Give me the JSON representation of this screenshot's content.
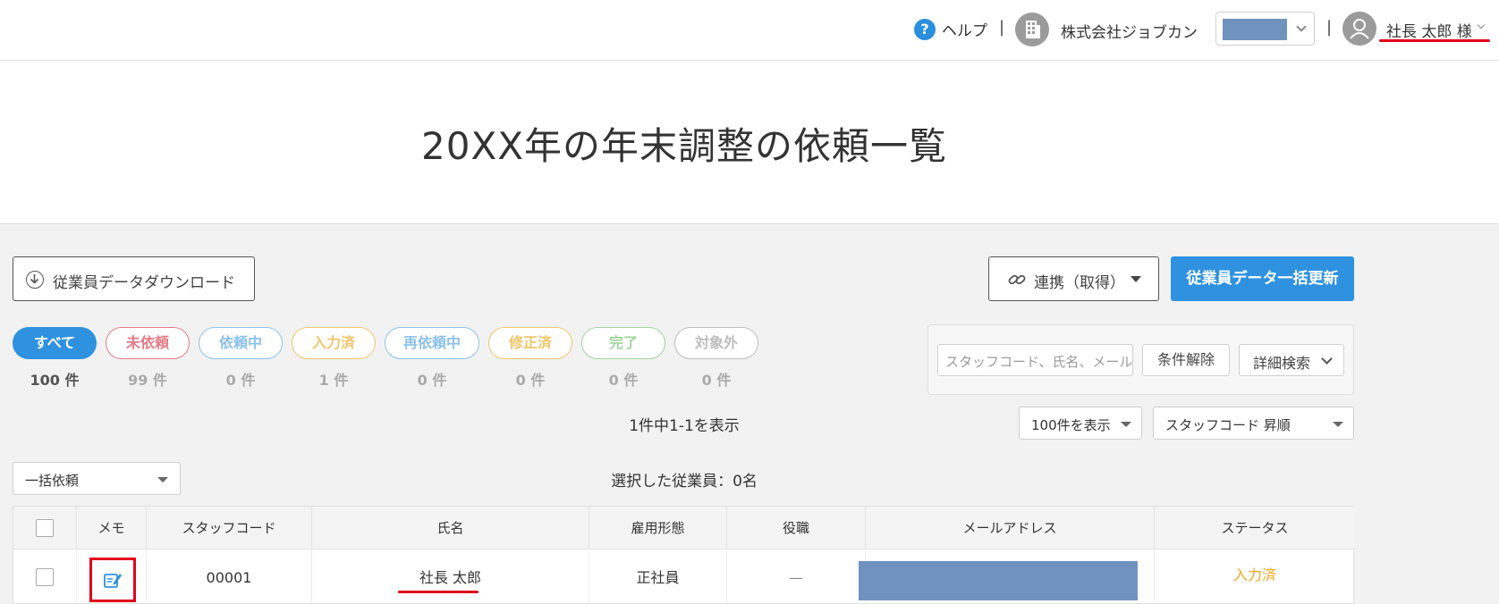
{
  "header": {
    "help_label": "ヘルプ",
    "separator": "|",
    "company_name": "株式会社ジョブカン",
    "user_name": "社長 太郎 様"
  },
  "page_title": "20XX年の年末調整の依頼一覧",
  "buttons": {
    "download": "従業員データダウンロード",
    "sync": "連携（取得）",
    "bulk_update": "従業員データ一括更新"
  },
  "status_filters": [
    {
      "label": "すべて",
      "count": "100 件",
      "color": "#2f92e0",
      "active": true
    },
    {
      "label": "未依頼",
      "count": "99 件",
      "color": "#e57a86",
      "active": false
    },
    {
      "label": "依頼中",
      "count": "0 件",
      "color": "#8cc1ea",
      "active": false
    },
    {
      "label": "入力済",
      "count": "1 件",
      "color": "#f0c56b",
      "active": false
    },
    {
      "label": "再依頼中",
      "count": "0 件",
      "color": "#8cc1ea",
      "active": false
    },
    {
      "label": "修正済",
      "count": "0 件",
      "color": "#f0c56b",
      "active": false
    },
    {
      "label": "完了",
      "count": "0 件",
      "color": "#9fd49c",
      "active": false
    },
    {
      "label": "対象外",
      "count": "0 件",
      "color": "#bdbdbd",
      "active": false
    }
  ],
  "search": {
    "placeholder": "スタッフコード、氏名、メールアドレス",
    "clear_label": "条件解除",
    "detail_label": "詳細検索"
  },
  "result_count": "1件中1-1を表示",
  "per_page_select": "100件を表示",
  "sort_select": "スタッフコード 昇順",
  "bulk_action_select": "一括依頼",
  "selected_count": "選択した従業員：0名",
  "table": {
    "headers": {
      "memo": "メモ",
      "staff_code": "スタッフコード",
      "name": "氏名",
      "employment_type": "雇用形態",
      "position": "役職",
      "email": "メールアドレス",
      "status": "ステータス"
    },
    "rows": [
      {
        "staff_code": "00001",
        "name": "社長 太郎",
        "employment_type": "正社員",
        "position": "—",
        "status": "入力済"
      }
    ]
  },
  "colors": {
    "accent": "#2f92e0",
    "status_input_done": "#f0a81c",
    "highlight": "#e0001b",
    "redaction": "#7092bf"
  }
}
